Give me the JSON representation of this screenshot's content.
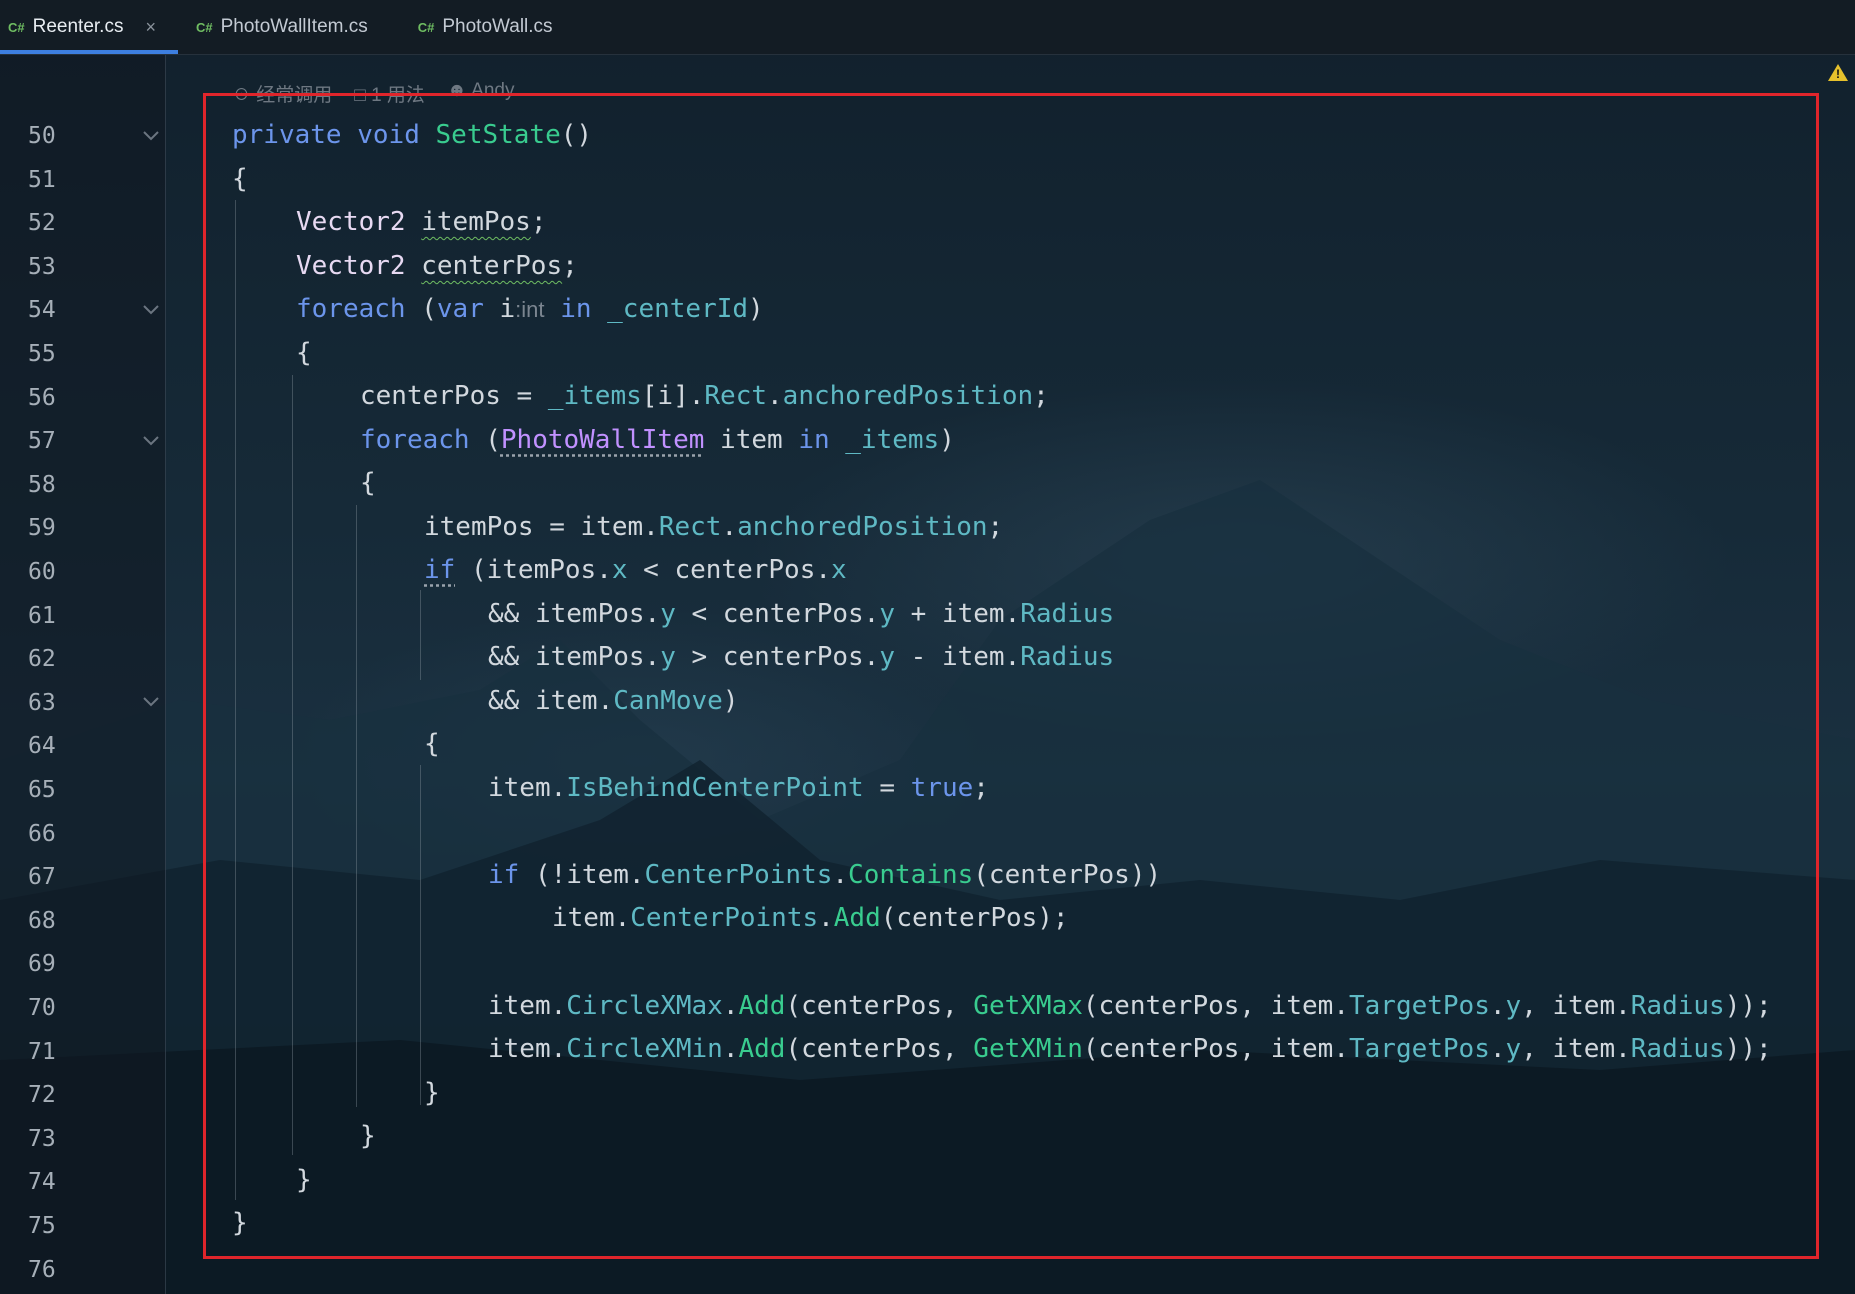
{
  "tabs": [
    {
      "lang": "C#",
      "label": "Reenter.cs",
      "active": true,
      "close": "×"
    },
    {
      "lang": "C#",
      "label": "PhotoWallItem.cs",
      "active": false
    },
    {
      "lang": "C#",
      "label": "PhotoWall.cs",
      "active": false
    }
  ],
  "meta": {
    "usage_hint": "经常调用",
    "usages": "1 用法",
    "author": "Andy"
  },
  "line_numbers": [
    "50",
    "51",
    "52",
    "53",
    "54",
    "55",
    "56",
    "57",
    "58",
    "59",
    "60",
    "61",
    "62",
    "63",
    "64",
    "65",
    "66",
    "67",
    "68",
    "69",
    "70",
    "71",
    "72",
    "73",
    "74",
    "75",
    "76"
  ],
  "code": {
    "l50": {
      "k1": "private",
      "k2": "void",
      "m": "SetState",
      "p": "()"
    },
    "l51": {
      "p": "{"
    },
    "l52": {
      "t": "Vector2",
      "v": "itemPos",
      "p": ";"
    },
    "l53": {
      "t": "Vector2",
      "v": "centerPos",
      "p": ";"
    },
    "l54": {
      "k1": "foreach",
      "p1": "(",
      "k2": "var",
      "v": "i",
      "hint": ":int",
      "k3": "in",
      "v2": "_centerId",
      "p2": ")"
    },
    "l55": {
      "p": "{"
    },
    "l56": {
      "a": "centerPos = ",
      "b": "_items",
      "c": "[i].",
      "d": "Rect",
      "e": ".",
      "f": "anchoredPosition",
      "g": ";"
    },
    "l57": {
      "k1": "foreach",
      "p1": "(",
      "c": "PhotoWallItem",
      "v": " item ",
      "k2": "in",
      "v2": " _items",
      "p2": ")"
    },
    "l58": {
      "p": "{"
    },
    "l59": {
      "a": "itemPos = item.",
      "d": "Rect",
      "e": ".",
      "f": "anchoredPosition",
      "g": ";"
    },
    "l60": {
      "k": "if",
      "a": " (itemPos.",
      "x": "x",
      "b": " < centerPos.",
      "x2": "x"
    },
    "l61": {
      "a": "&& itemPos.",
      "y": "y",
      "b": " < centerPos.",
      "y2": "y",
      "c": " + item.",
      "r": "Radius"
    },
    "l62": {
      "a": "&& itemPos.",
      "y": "y",
      "b": " > centerPos.",
      "y2": "y",
      "c": " - item.",
      "r": "Radius"
    },
    "l63": {
      "a": "&& item.",
      "m": "CanMove",
      "p": ")"
    },
    "l64": {
      "p": "{"
    },
    "l65": {
      "a": "item.",
      "pr": "IsBehindCenterPoint",
      "b": " = ",
      "k": "true",
      "p": ";"
    },
    "l67": {
      "k": "if",
      "a": " (!item.",
      "pr": "CenterPoints",
      "b": ".",
      "m": "Contains",
      "c": "(centerPos))"
    },
    "l68": {
      "a": "item.",
      "pr": "CenterPoints",
      "b": ".",
      "m": "Add",
      "c": "(centerPos);"
    },
    "l70": {
      "a": "item.",
      "pr": "CircleXMax",
      "b": ".",
      "m": "Add",
      "c": "(centerPos, ",
      "m2": "GetXMax",
      "d": "(centerPos, item.",
      "pr2": "TargetPos",
      "e": ".",
      "y": "y",
      "f": ", item.",
      "r": "Radius",
      "g": "));"
    },
    "l71": {
      "a": "item.",
      "pr": "CircleXMin",
      "b": ".",
      "m": "Add",
      "c": "(centerPos, ",
      "m2": "GetXMin",
      "d": "(centerPos, item.",
      "pr2": "TargetPos",
      "e": ".",
      "y": "y",
      "f": ", item.",
      "r": "Radius",
      "g": "));"
    },
    "l72": {
      "p": "}"
    },
    "l73": {
      "p": "}"
    },
    "l74": {
      "p": "}"
    },
    "l75": {
      "p": "}"
    }
  },
  "warning_glyph": "!"
}
